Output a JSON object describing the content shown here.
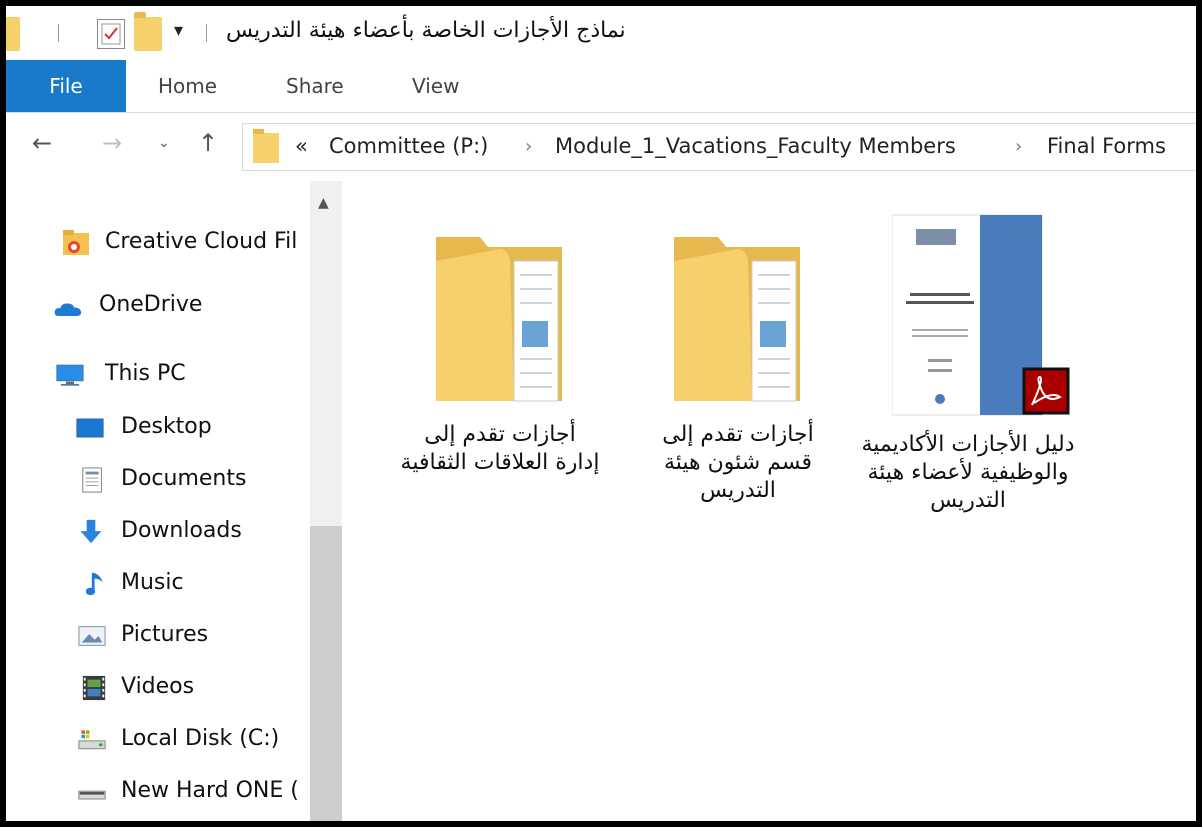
{
  "window": {
    "title": "نماذج الأجازات الخاصة بأعضاء هيئة التدريس"
  },
  "ribbon": {
    "tabs": [
      {
        "label": "File",
        "active": true
      },
      {
        "label": "Home"
      },
      {
        "label": "Share"
      },
      {
        "label": "View"
      }
    ],
    "accent": "#1979ca"
  },
  "address": {
    "overflow": "«",
    "crumbs": [
      "Committee (P:)",
      "Module_1_Vacations_Faculty Members",
      "Final Forms"
    ],
    "separator": "›"
  },
  "nav": {
    "items": [
      {
        "label": "Creative Cloud Fil",
        "icon": "creative-cloud-icon"
      },
      {
        "label": "OneDrive",
        "icon": "onedrive-icon"
      },
      {
        "label": "This PC",
        "icon": "this-pc-icon"
      },
      {
        "label": "Desktop",
        "icon": "desktop-icon"
      },
      {
        "label": "Documents",
        "icon": "documents-icon"
      },
      {
        "label": "Downloads",
        "icon": "downloads-icon"
      },
      {
        "label": "Music",
        "icon": "music-icon"
      },
      {
        "label": "Pictures",
        "icon": "pictures-icon"
      },
      {
        "label": "Videos",
        "icon": "videos-icon"
      },
      {
        "label": "Local Disk (C:)",
        "icon": "local-disk-icon"
      },
      {
        "label": "New Hard ONE (",
        "icon": "hard-drive-icon"
      }
    ]
  },
  "files": [
    {
      "name": "أجازات تقدم إلى إدارة العلاقات الثقافية",
      "type": "folder"
    },
    {
      "name": "أجازات تقدم إلى قسم شئون هيئة التدريس",
      "type": "folder"
    },
    {
      "name": "دليل الأجازات الأكاديمية والوظيفية لأعضاء هيئة التدريس",
      "type": "pdf"
    }
  ]
}
